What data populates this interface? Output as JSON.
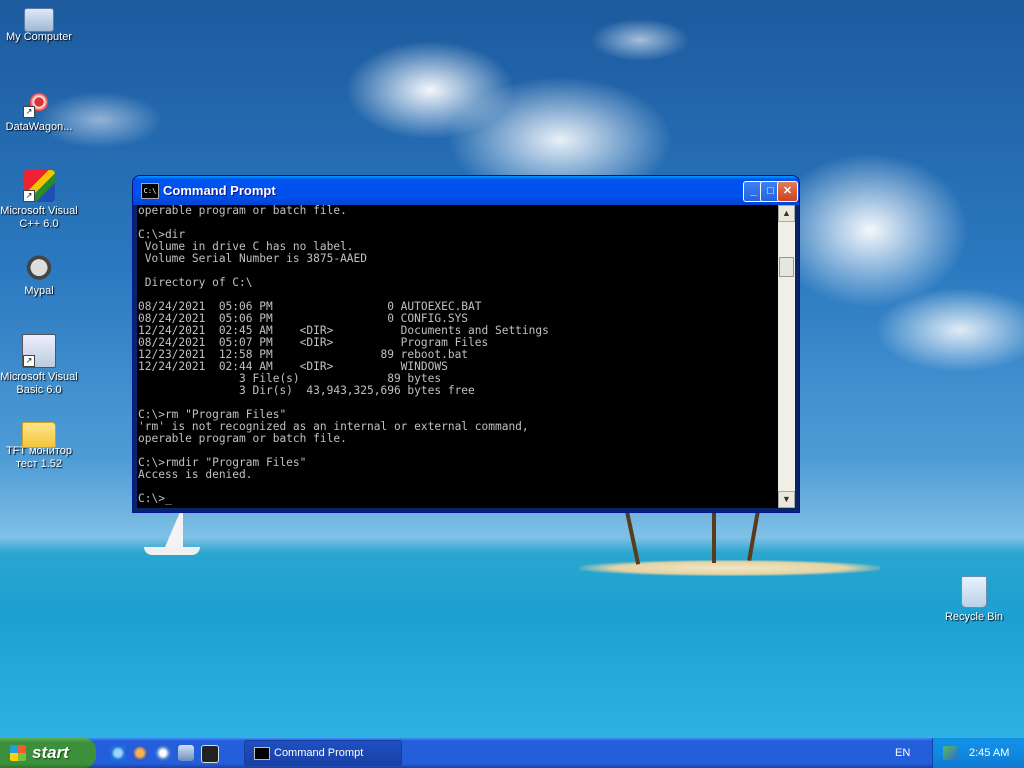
{
  "desktop": {
    "icons": [
      {
        "label": "My Computer",
        "icon": "computer-icon"
      },
      {
        "label": "DataWagon...",
        "icon": "datawagon-icon"
      },
      {
        "label": "Microsoft Visual C++ 6.0",
        "icon": "visual-cpp-icon"
      },
      {
        "label": "Mypal",
        "icon": "mypal-icon"
      },
      {
        "label": "Microsoft Visual Basic 6.0",
        "icon": "visual-basic-icon"
      },
      {
        "label": "TFT монитор тест 1.52",
        "icon": "folder-icon"
      }
    ],
    "recycle_bin": {
      "label": "Recycle Bin",
      "icon": "recycle-bin-icon"
    }
  },
  "window": {
    "title": "Command Prompt",
    "icon_text": "C:\\",
    "buttons": {
      "minimize": "_",
      "maximize": "□",
      "close": "✕"
    },
    "console_lines": [
      "operable program or batch file.",
      "",
      "C:\\>dir",
      " Volume in drive C has no label.",
      " Volume Serial Number is 3875-AAED",
      "",
      " Directory of C:\\",
      "",
      "08/24/2021  05:06 PM                 0 AUTOEXEC.BAT",
      "08/24/2021  05:06 PM                 0 CONFIG.SYS",
      "12/24/2021  02:45 AM    <DIR>          Documents and Settings",
      "08/24/2021  05:07 PM    <DIR>          Program Files",
      "12/23/2021  12:58 PM                89 reboot.bat",
      "12/24/2021  02:44 AM    <DIR>          WINDOWS",
      "               3 File(s)             89 bytes",
      "               3 Dir(s)  43,943,325,696 bytes free",
      "",
      "C:\\>rm \"Program Files\"",
      "'rm' is not recognized as an internal or external command,",
      "operable program or batch file.",
      "",
      "C:\\>rmdir \"Program Files\"",
      "Access is denied.",
      "",
      "C:\\>_"
    ]
  },
  "taskbar": {
    "start_label": "start",
    "quick_launch": [
      "ie-icon",
      "firefox-icon",
      "media-icon",
      "monitor-icon",
      "7zip-icon"
    ],
    "task_label": "Command Prompt",
    "task_icon_text": "C:\\",
    "language": "EN",
    "clock": "2:45 AM"
  }
}
